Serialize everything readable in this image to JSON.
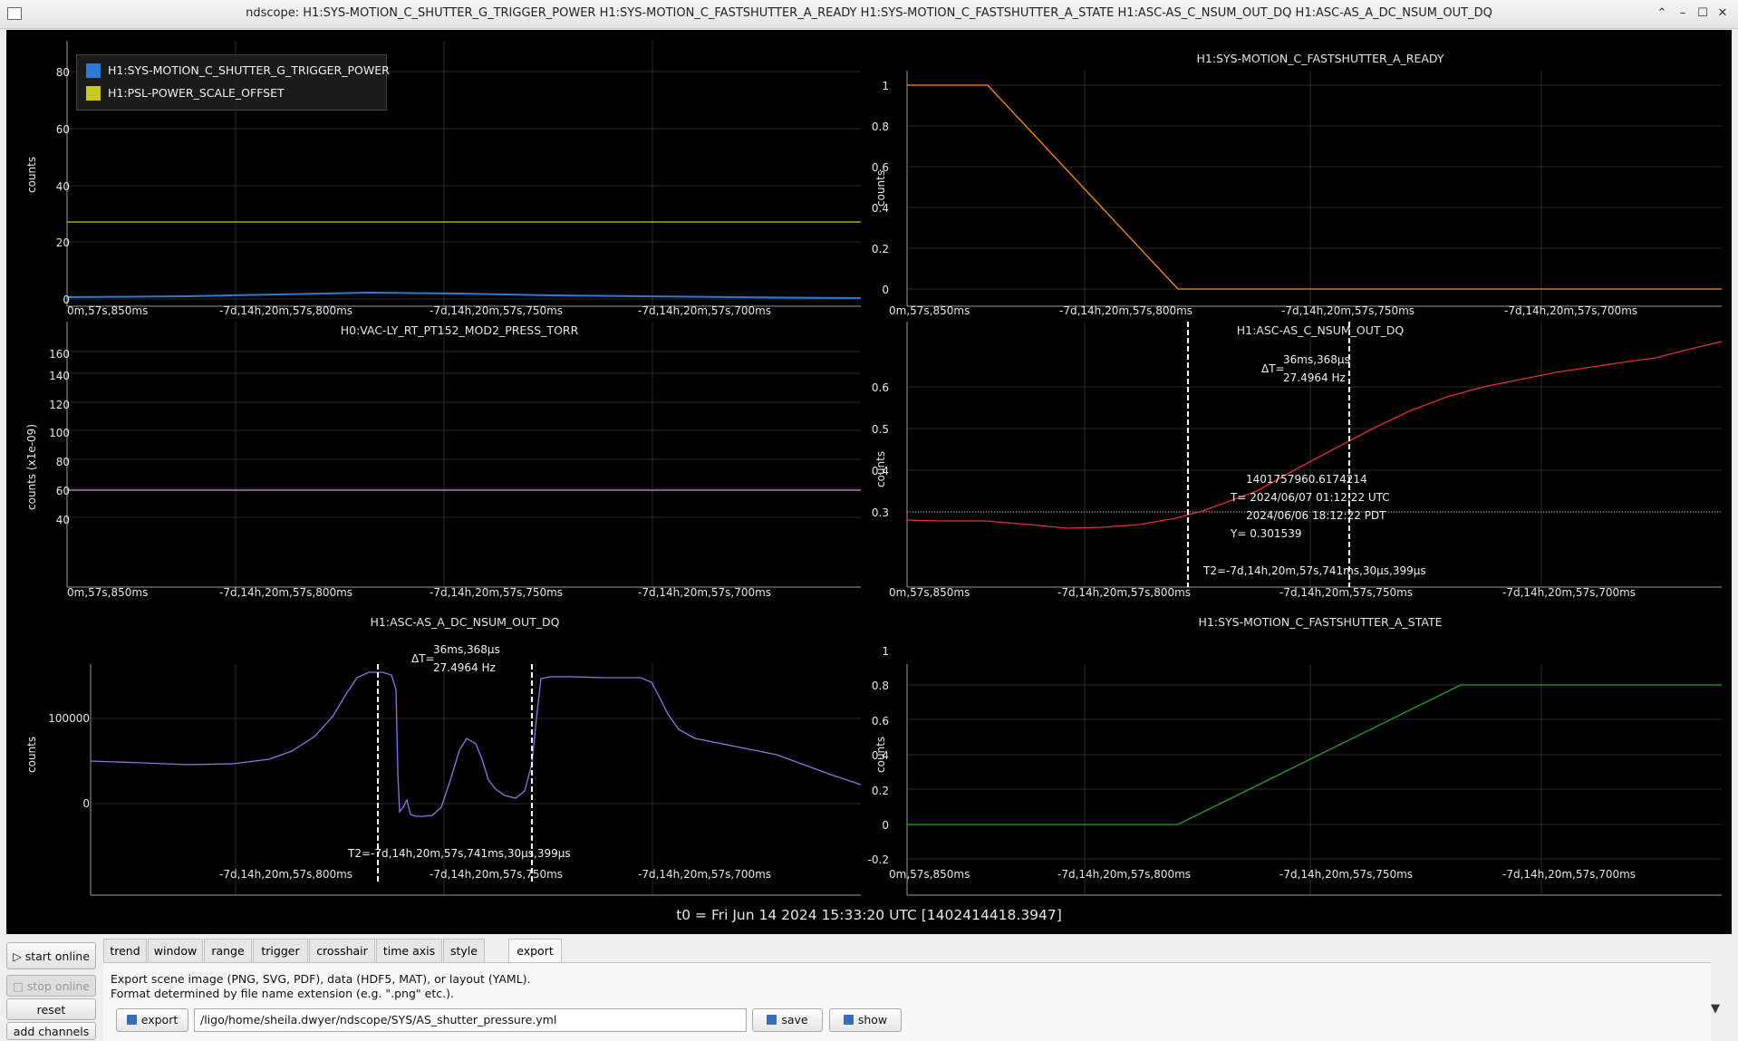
{
  "window": {
    "title": "ndscope: H1:SYS-MOTION_C_SHUTTER_G_TRIGGER_POWER H1:SYS-MOTION_C_FASTSHUTTER_A_READY H1:SYS-MOTION_C_FASTSHUTTER_A_STATE H1:ASC-AS_C_NSUM_OUT_DQ H1:ASC-AS_A_DC_NSUM_OUT_DQ",
    "controls": {
      "restore": "⌃",
      "minimize": "–",
      "maximize": "☐",
      "close": "✕"
    }
  },
  "colors": {
    "blue": "#2b7bd0",
    "yellow": "#c8c81e",
    "orange": "#ff8c1a",
    "pink": "#d98cd9",
    "red": "#e03030",
    "purple": "#9b6ee0",
    "green": "#2aa02a"
  },
  "xticks": [
    "-7d,14h,20m,57s,850ms",
    "-7d,14h,20m,57s,800ms",
    "-7d,14h,20m,57s,750ms",
    "-7d,14h,20m,57s,700ms"
  ],
  "xticks_clipped": "0m,57s,850ms",
  "t0": "t0 = Fri Jun 14 2024 15:33:20 UTC [1402414418.3947]",
  "plots": {
    "p1": {
      "ylabel": "counts",
      "yticks": [
        "80",
        "60",
        "40",
        "20",
        "0"
      ],
      "legend": [
        {
          "label": "H1:SYS-MOTION_C_SHUTTER_G_TRIGGER_POWER",
          "color": "blue"
        },
        {
          "label": "H1:PSL-POWER_SCALE_OFFSET",
          "color": "yellow"
        }
      ]
    },
    "p2": {
      "title": "H1:SYS-MOTION_C_FASTSHUTTER_A_READY",
      "ylabel": "counts",
      "yticks": [
        "1",
        "0.8",
        "0.6",
        "0.4",
        "0.2",
        "0"
      ]
    },
    "p3": {
      "title": "H0:VAC-LY_RT_PT152_MOD2_PRESS_TORR",
      "ylabel": "counts (x1e-09)",
      "yticks": [
        "160",
        "140",
        "120",
        "100",
        "80",
        "60",
        "40"
      ]
    },
    "p4": {
      "title": "H1:ASC-AS_C_NSUM_OUT_DQ",
      "ylabel": "counts",
      "yticks": [
        "0.6",
        "0.5",
        "0.4",
        "0.3"
      ],
      "delta": {
        "prefix": "ΔT=",
        "line1": "36ms,368μs",
        "line2": "27.4964 Hz"
      },
      "cursor": {
        "gps": "1401757960.6174214",
        "t_utc": "T= 2024/06/07 01:12:22 UTC",
        "t_pdt": "2024/06/06 18:12:22 PDT",
        "y": "Y= 0.301539"
      },
      "t2": "T2=-7d,14h,20m,57s,741ms,30μs,399μs"
    },
    "p5": {
      "title": "H1:ASC-AS_A_DC_NSUM_OUT_DQ",
      "ylabel": "counts",
      "yticks": [
        "100000",
        "0"
      ],
      "delta": {
        "prefix": "ΔT=",
        "line1": "36ms,368μs",
        "line2": "27.4964 Hz"
      },
      "t2": "T2=-7d,14h,20m,57s,741ms,30μs,399μs"
    },
    "p6": {
      "title": "H1:SYS-MOTION_C_FASTSHUTTER_A_STATE",
      "ylabel": "counts",
      "yticks": [
        "1",
        "0.8",
        "0.6",
        "0.4",
        "0.2",
        "0",
        "-0.2"
      ]
    }
  },
  "side_buttons": {
    "start": "start online",
    "stop": "stop online",
    "reset": "reset",
    "add": "add channels"
  },
  "tabs": [
    "trend",
    "window",
    "range",
    "trigger",
    "crosshair",
    "time axis",
    "style",
    "export"
  ],
  "export": {
    "desc1": "Export scene image (PNG, SVG, PDF), data (HDF5, MAT), or layout (YAML).",
    "desc2": "Format determined by file name extension (e.g. \".png\" etc.).",
    "export_label": "export",
    "path": "/ligo/home/sheila.dwyer/ndscope/SYS/AS_shutter_pressure.yml",
    "save_label": "save",
    "show_label": "show"
  }
}
